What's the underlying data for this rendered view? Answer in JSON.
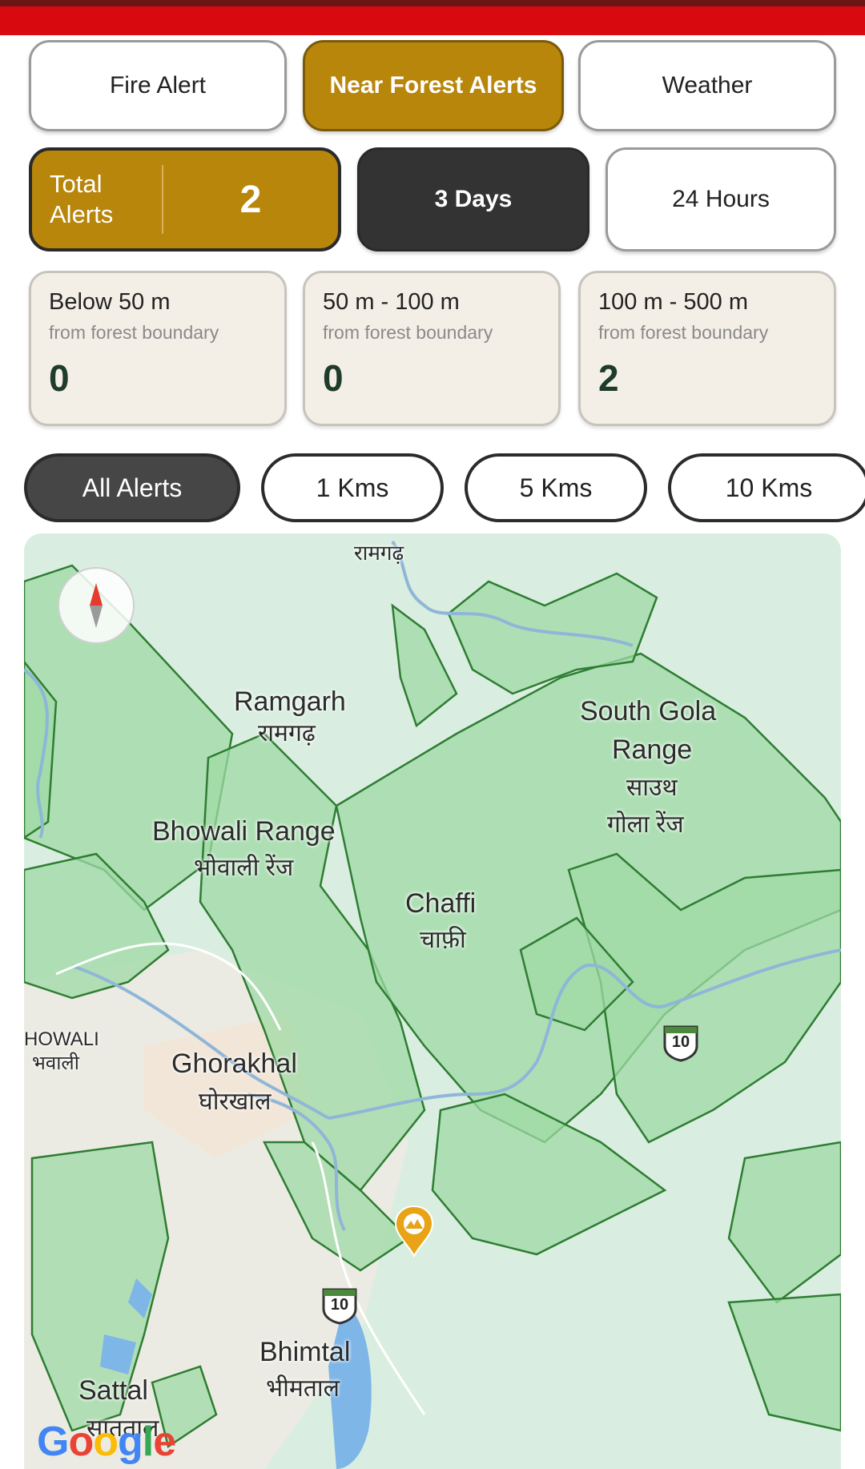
{
  "tabs": [
    {
      "label": "Fire Alert",
      "active": false
    },
    {
      "label": "Near Forest Alerts",
      "active": true
    },
    {
      "label": "Weather",
      "active": false
    }
  ],
  "summary": {
    "total_label": "Total Alerts",
    "total_count": "2",
    "period_3d": "3 Days",
    "period_24h": "24 Hours"
  },
  "distance_stats": [
    {
      "range": "Below 50 m",
      "caption": "from forest boundary",
      "count": "0"
    },
    {
      "range": "50 m - 100 m",
      "caption": "from forest boundary",
      "count": "0"
    },
    {
      "range": "100 m - 500 m",
      "caption": "from forest boundary",
      "count": "2"
    }
  ],
  "filters": [
    {
      "label": "All Alerts",
      "active": true
    },
    {
      "label": "1 Kms",
      "active": false
    },
    {
      "label": "5 Kms",
      "active": false
    },
    {
      "label": "10 Kms",
      "active": false
    }
  ],
  "map": {
    "labels": {
      "top_hindi": "रामगढ़",
      "ramgarh_en": "Ramgarh",
      "ramgarh_hi": "रामगढ़",
      "south_gola_en_1": "South Gola",
      "south_gola_en_2": "Range",
      "south_gola_hi_1": "साउथ",
      "south_gola_hi_2": "गोला रेंज",
      "bhowali_en": "Bhowali Range",
      "bhowali_hi": "भोवाली रेंज",
      "chaffi_en": "Chaffi",
      "chaffi_hi": "चाफ़ी",
      "howali_en": "HOWALI",
      "howali_hi": "भवाली",
      "ghorakhal_en": "Ghorakhal",
      "ghorakhal_hi": "घोरखाल",
      "bhimtal_en": "Bhimtal",
      "bhimtal_hi": "भीमताल",
      "sattal_en": "Sattal",
      "sattal_hi": "सातताल",
      "highway_a": "10",
      "highway_b": "10"
    },
    "attribution": "Google",
    "colors": {
      "forest_fill": "#9fd9a6",
      "forest_stroke": "#2e7d32",
      "marker": "#e8a317",
      "water": "#7eb6e8"
    }
  }
}
